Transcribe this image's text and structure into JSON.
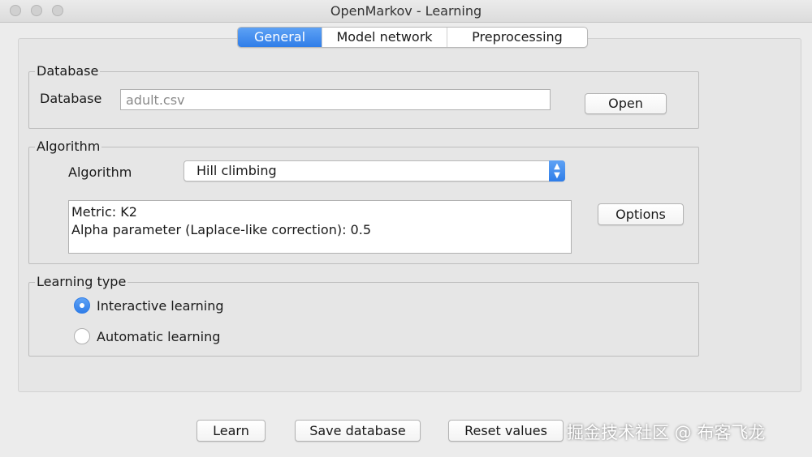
{
  "window": {
    "title": "OpenMarkov - Learning"
  },
  "tabs": [
    {
      "label": "General",
      "active": true
    },
    {
      "label": "Model network",
      "active": false
    },
    {
      "label": "Preprocessing",
      "active": false
    }
  ],
  "database_group": {
    "legend": "Database",
    "field_label": "Database",
    "field_value": "adult.csv",
    "open_label": "Open"
  },
  "algorithm_group": {
    "legend": "Algorithm",
    "field_label": "Algorithm",
    "selected": "Hill climbing",
    "details": [
      "Metric: K2",
      "Alpha parameter (Laplace-like correction): 0.5"
    ],
    "options_label": "Options"
  },
  "learning_type_group": {
    "legend": "Learning type",
    "options": [
      {
        "label": "Interactive learning",
        "checked": true
      },
      {
        "label": "Automatic learning",
        "checked": false
      }
    ]
  },
  "footer": {
    "learn_label": "Learn",
    "save_label": "Save database",
    "reset_label": "Reset values"
  },
  "watermark": "掘金技术社区 @ 布客飞龙",
  "colors": {
    "accent": "#2f7de8",
    "background": "#ececec"
  }
}
